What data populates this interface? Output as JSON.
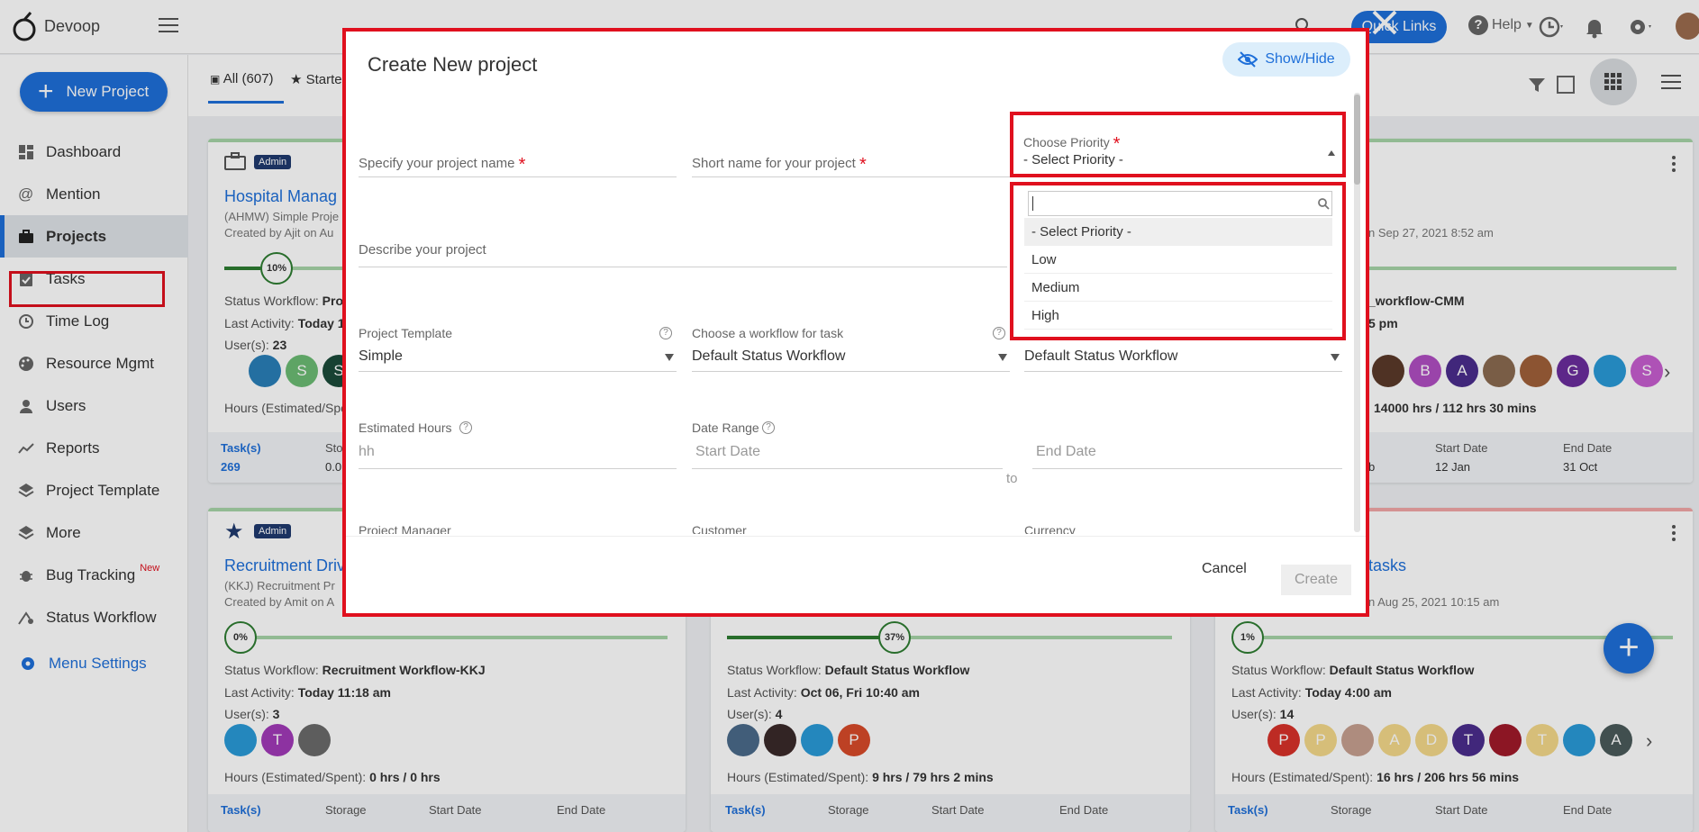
{
  "topbar": {
    "brand": "Devoop",
    "quick_links": "Quick Links",
    "help": "Help"
  },
  "sidebar": {
    "new_project": "New Project",
    "items": [
      {
        "label": "Dashboard",
        "icon": "dashboard-icon"
      },
      {
        "label": "Mention",
        "icon": "at-icon"
      },
      {
        "label": "Projects",
        "icon": "briefcase-icon",
        "active": true
      },
      {
        "label": "Tasks",
        "icon": "clipboard-check-icon"
      },
      {
        "label": "Time Log",
        "icon": "clock-icon"
      },
      {
        "label": "Resource Mgmt",
        "icon": "palette-icon"
      },
      {
        "label": "Users",
        "icon": "user-icon"
      },
      {
        "label": "Reports",
        "icon": "chart-line-icon"
      },
      {
        "label": "Project Template",
        "icon": "layers-icon"
      },
      {
        "label": "More",
        "icon": "layers-icon"
      },
      {
        "label": "Bug Tracking",
        "icon": "bug-icon",
        "badge": "New"
      },
      {
        "label": "Status Workflow",
        "icon": "workflow-icon"
      }
    ],
    "menu_settings": "Menu Settings"
  },
  "tabs": {
    "all": "All (607)",
    "starred": "Starte"
  },
  "cards": {
    "c1": {
      "badge": "Admin",
      "title": "Hospital Manag",
      "sub": "(AHMW) Simple Proje",
      "created": "Created by Ajit on Au",
      "progress": "10%",
      "status_label": "Status Workflow:",
      "status_value": "Pro",
      "activity_label": "Last Activity:",
      "activity_value": "Today 1",
      "users_label": "User(s):",
      "users_value": "23",
      "hours": "Hours (Estimated/Spen",
      "tasks_label": "Task(s)",
      "tasks_value": "269",
      "storage_label": "Sto",
      "storage_value": "0.0"
    },
    "c3": {
      "created": "n Sep 27, 2021 8:52 am",
      "status_value": "_workflow-CMM",
      "activity_value": "5 pm",
      "hours": "14000 hrs / 112 hrs 30 mins",
      "storage_value": "b",
      "start_label": "Start Date",
      "start_value": "12 Jan",
      "end_label": "End Date",
      "end_value": "31 Oct"
    },
    "c4": {
      "badge": "Admin",
      "title": "Recruitment Driv",
      "sub": "(KKJ) Recruitment Pr",
      "created": "Created by Amit on A",
      "progress": "0%",
      "status_label": "Status Workflow:",
      "status_value": "Recruitment Workflow-KKJ",
      "activity_label": "Last Activity:",
      "activity_value": "Today 11:18 am",
      "users_label": "User(s):",
      "users_value": "3",
      "hours_label": "Hours (Estimated/Spent):",
      "hours_value": "0 hrs / 0 hrs",
      "tasks_label": "Task(s)",
      "storage_label": "Storage",
      "start_label": "Start Date",
      "end_label": "End Date"
    },
    "c5": {
      "progress": "37%",
      "status_label": "Status Workflow:",
      "status_value": "Default Status Workflow",
      "activity_label": "Last Activity:",
      "activity_value": "Oct 06, Fri 10:40 am",
      "users_label": "User(s):",
      "users_value": "4",
      "hours_label": "Hours (Estimated/Spent):",
      "hours_value": "9 hrs / 79 hrs 2 mins",
      "tasks_label": "Task(s)",
      "storage_label": "Storage",
      "start_label": "Start Date",
      "end_label": "End Date"
    },
    "c6": {
      "title": "tasks",
      "created": "n Aug 25, 2021 10:15 am",
      "progress": "1%",
      "status_label": "Status Workflow:",
      "status_value": "Default Status Workflow",
      "activity_label": "Last Activity:",
      "activity_value": "Today 4:00 am",
      "users_label": "User(s):",
      "users_value": "14",
      "hours_label": "Hours (Estimated/Spent):",
      "hours_value": "16 hrs / 206 hrs 56 mins",
      "tasks_label": "Task(s)",
      "storage_label": "Storage",
      "start_label": "Start Date",
      "end_label": "End Date"
    }
  },
  "modal": {
    "title": "Create New project",
    "show_hide": "Show/Hide",
    "project_name_placeholder": "Specify your project name",
    "short_name_placeholder": "Short name for your project",
    "priority_label": "Choose Priority",
    "priority_value": "- Select Priority -",
    "priority_options": [
      "- Select Priority -",
      "Low",
      "Medium",
      "High"
    ],
    "describe_placeholder": "Describe your project",
    "template_label": "Project Template",
    "template_value": "Simple",
    "workflow_label": "Choose a workflow for task",
    "workflow_value": "Default Status Workflow",
    "workflow2_value": "Default Status Workflow",
    "est_hours_label": "Estimated Hours",
    "est_hours_placeholder": "hh",
    "date_range_label": "Date Range",
    "start_date_placeholder": "Start Date",
    "end_date_placeholder": "End Date",
    "to": "to",
    "project_manager_label": "Project Manager",
    "customer_label": "Customer",
    "currency_label": "Currency",
    "cancel": "Cancel",
    "create": "Create"
  },
  "colors": {
    "accent": "#1e6fd9",
    "highlight": "#e0101e",
    "progress": "#2e7d32"
  }
}
